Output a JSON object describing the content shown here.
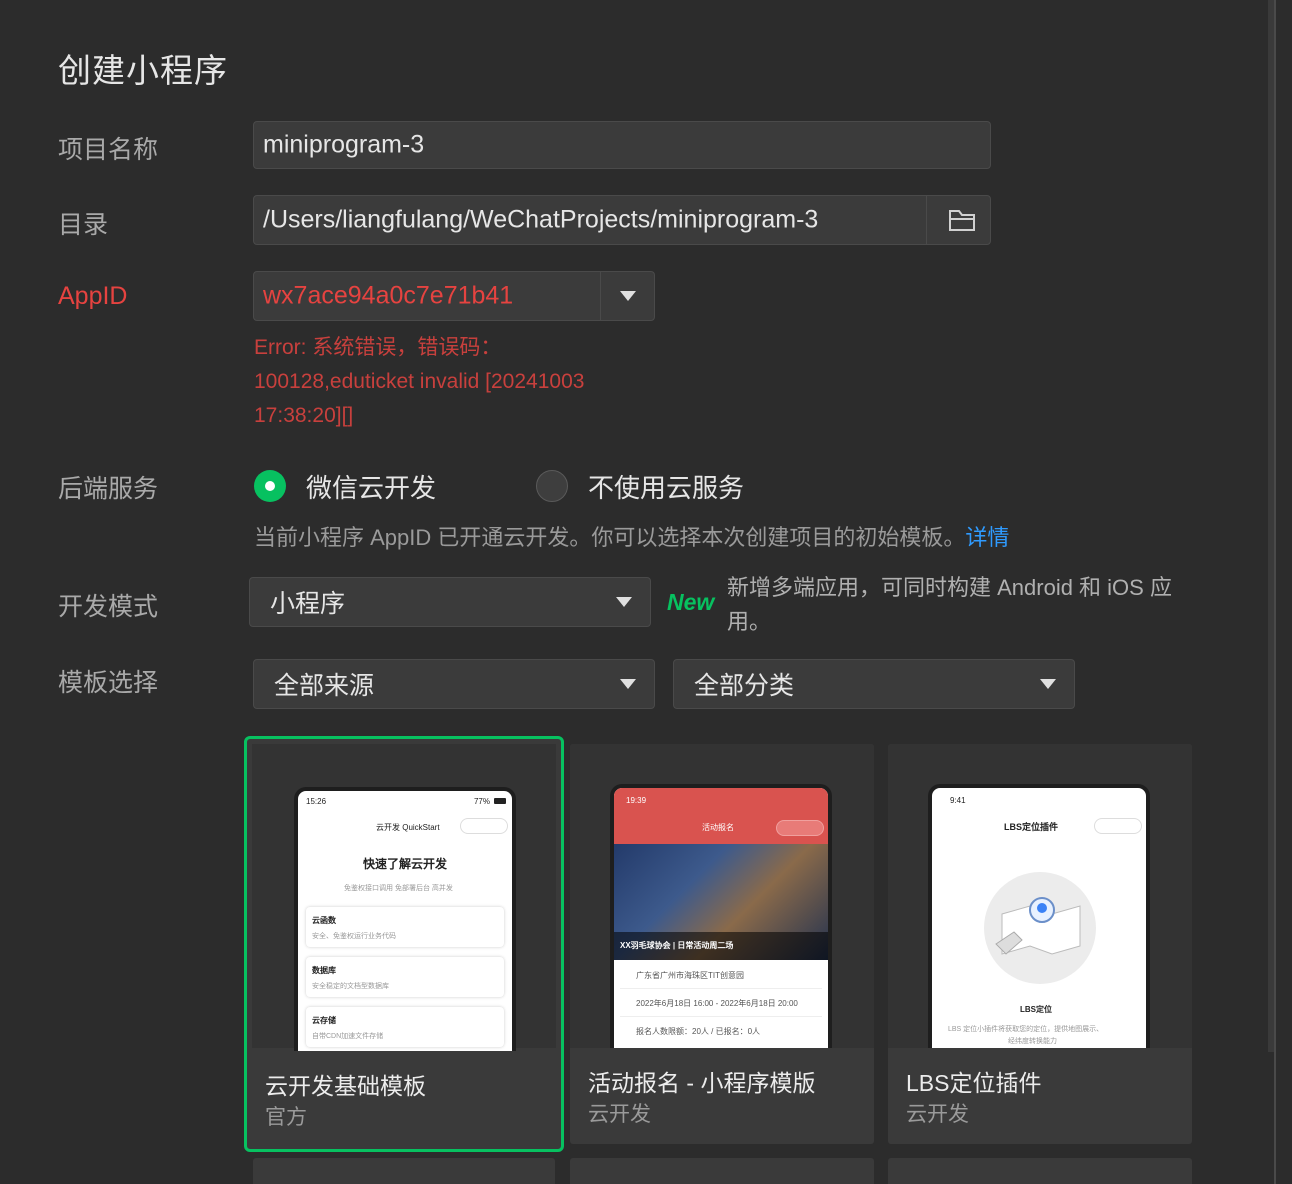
{
  "dialog": {
    "title": "创建小程序"
  },
  "project_name": {
    "label": "项目名称",
    "value": "miniprogram-3"
  },
  "directory": {
    "label": "目录",
    "value": "/Users/liangfulang/WeChatProjects/miniprogram-3",
    "icon": "folder-icon"
  },
  "appid": {
    "label": "AppID",
    "value": "wx7ace94a0c7e71b41",
    "error_line1": "Error: 系统错误，错误码：",
    "error_line2": "100128,eduticket invalid [20241003",
    "error_line3": "17:38:20][]"
  },
  "backend": {
    "label": "后端服务",
    "options": [
      {
        "label": "微信云开发",
        "selected": true
      },
      {
        "label": "不使用云服务",
        "selected": false
      }
    ],
    "hint": "当前小程序 AppID 已开通云开发。你可以选择本次创建项目的初始模板。",
    "link": "详情"
  },
  "dev_mode": {
    "label": "开发模式",
    "value": "小程序",
    "badge": "New",
    "note_line1": "新增多端应用，可同时构建 Android 和 iOS 应",
    "note_line2": "用。"
  },
  "template": {
    "label": "模板选择",
    "source": "全部来源",
    "category": "全部分类",
    "cards": [
      {
        "name": "云开发基础模板",
        "source": "官方",
        "selected": true,
        "preview": {
          "time": "15:26",
          "battery": "77%",
          "nav": "云开发 QuickStart",
          "headline": "快速了解云开发",
          "desc": "免鉴权接口调用 免部署后台 高并发",
          "items": [
            {
              "title": "云函数",
              "desc": "安全、免鉴权运行业务代码"
            },
            {
              "title": "数据库",
              "desc": "安全稳定的文档型数据库"
            },
            {
              "title": "云存储",
              "desc": "自带CDN加速文件存储"
            }
          ]
        }
      },
      {
        "name": "活动报名 - 小程序模版",
        "source": "云开发",
        "selected": false,
        "preview": {
          "time": "19:39",
          "nav": "活动报名",
          "banner": "XX羽毛球协会 | 日常活动周二场",
          "rows": [
            "广东省广州市海珠区TIT创意园",
            "2022年6月18日 16:00 - 2022年6月18日 20:00",
            "报名人数限额：20人 / 已报名：0人"
          ]
        }
      },
      {
        "name": "LBS定位插件",
        "source": "云开发",
        "selected": false,
        "preview": {
          "time": "9:41",
          "nav": "LBS定位插件",
          "caption": "LBS定位",
          "desc1": "LBS 定位小插件将获取您的定位，提供地图展示、",
          "desc2": "经纬度转换能力"
        }
      }
    ]
  },
  "colors": {
    "background": "#2c2c2c",
    "accent": "#07c160",
    "error": "#e64340",
    "link": "#2f9bff"
  }
}
